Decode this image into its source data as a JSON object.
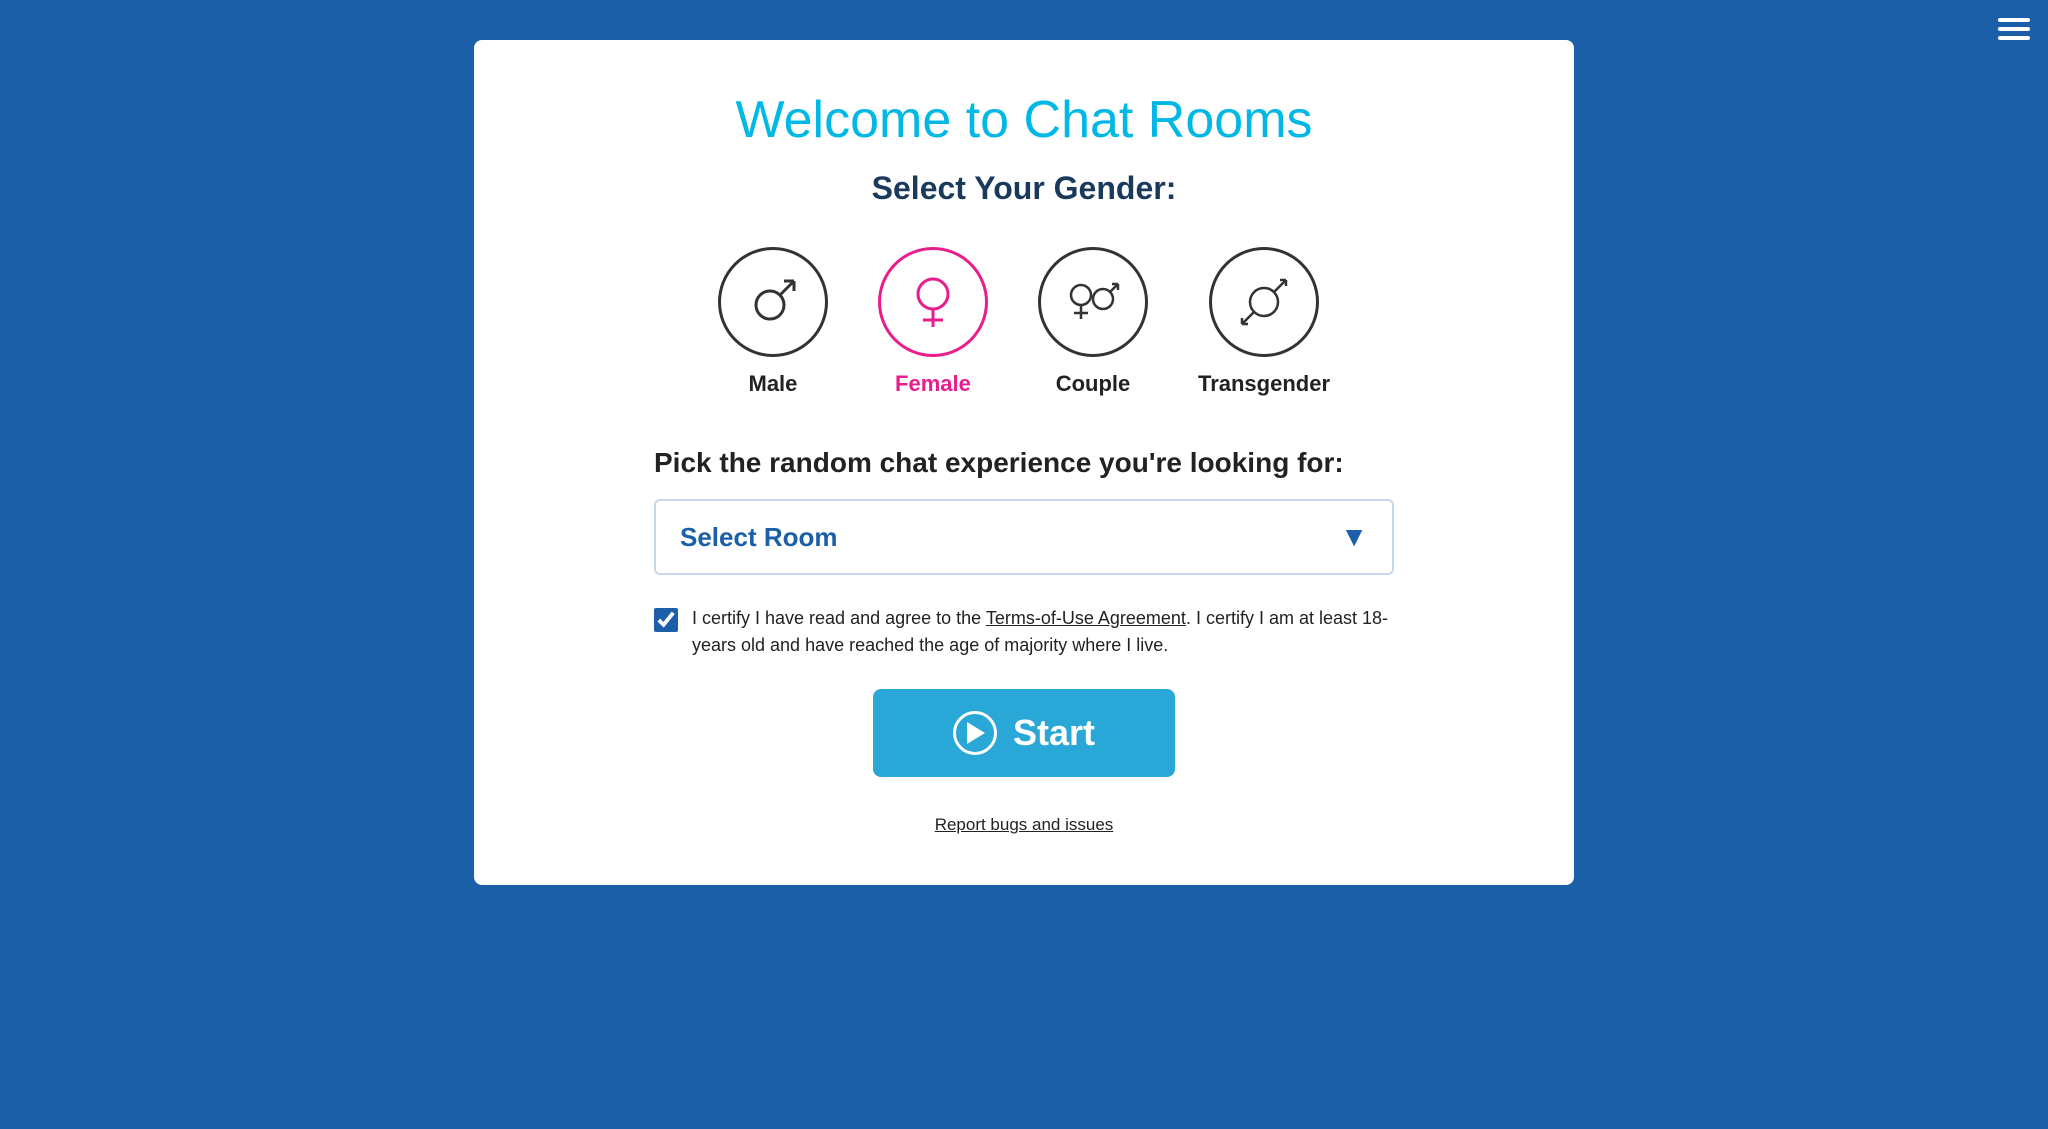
{
  "header": {
    "title": "Welcome to Chat Rooms"
  },
  "gender_section": {
    "heading": "Select Your Gender:",
    "options": [
      {
        "id": "male",
        "label": "Male",
        "symbol": "♂",
        "selected": false
      },
      {
        "id": "female",
        "label": "Female",
        "symbol": "♀",
        "selected": true
      },
      {
        "id": "couple",
        "label": "Couple",
        "symbol": "⁈",
        "selected": false
      },
      {
        "id": "transgender",
        "label": "Transgender",
        "symbol": "⚧",
        "selected": false
      }
    ]
  },
  "experience_section": {
    "heading": "Pick the random chat experience you're looking for:",
    "select_placeholder": "Select Room"
  },
  "terms": {
    "checkbox_label_part1": "I certify I have read and agree to the ",
    "terms_link_text": "Terms-of-Use Agreement",
    "checkbox_label_part2": ". I certify I am at least 18-years old and have reached the age of majority where I live.",
    "checked": true
  },
  "start_button": {
    "label": "Start"
  },
  "footer": {
    "report_link": "Report bugs and issues"
  },
  "colors": {
    "accent_blue": "#29a8d8",
    "title_blue": "#00b8e6",
    "dark_blue": "#1a5fa8",
    "female_pink": "#e91e8c",
    "background_blue": "#1a5fa8"
  }
}
